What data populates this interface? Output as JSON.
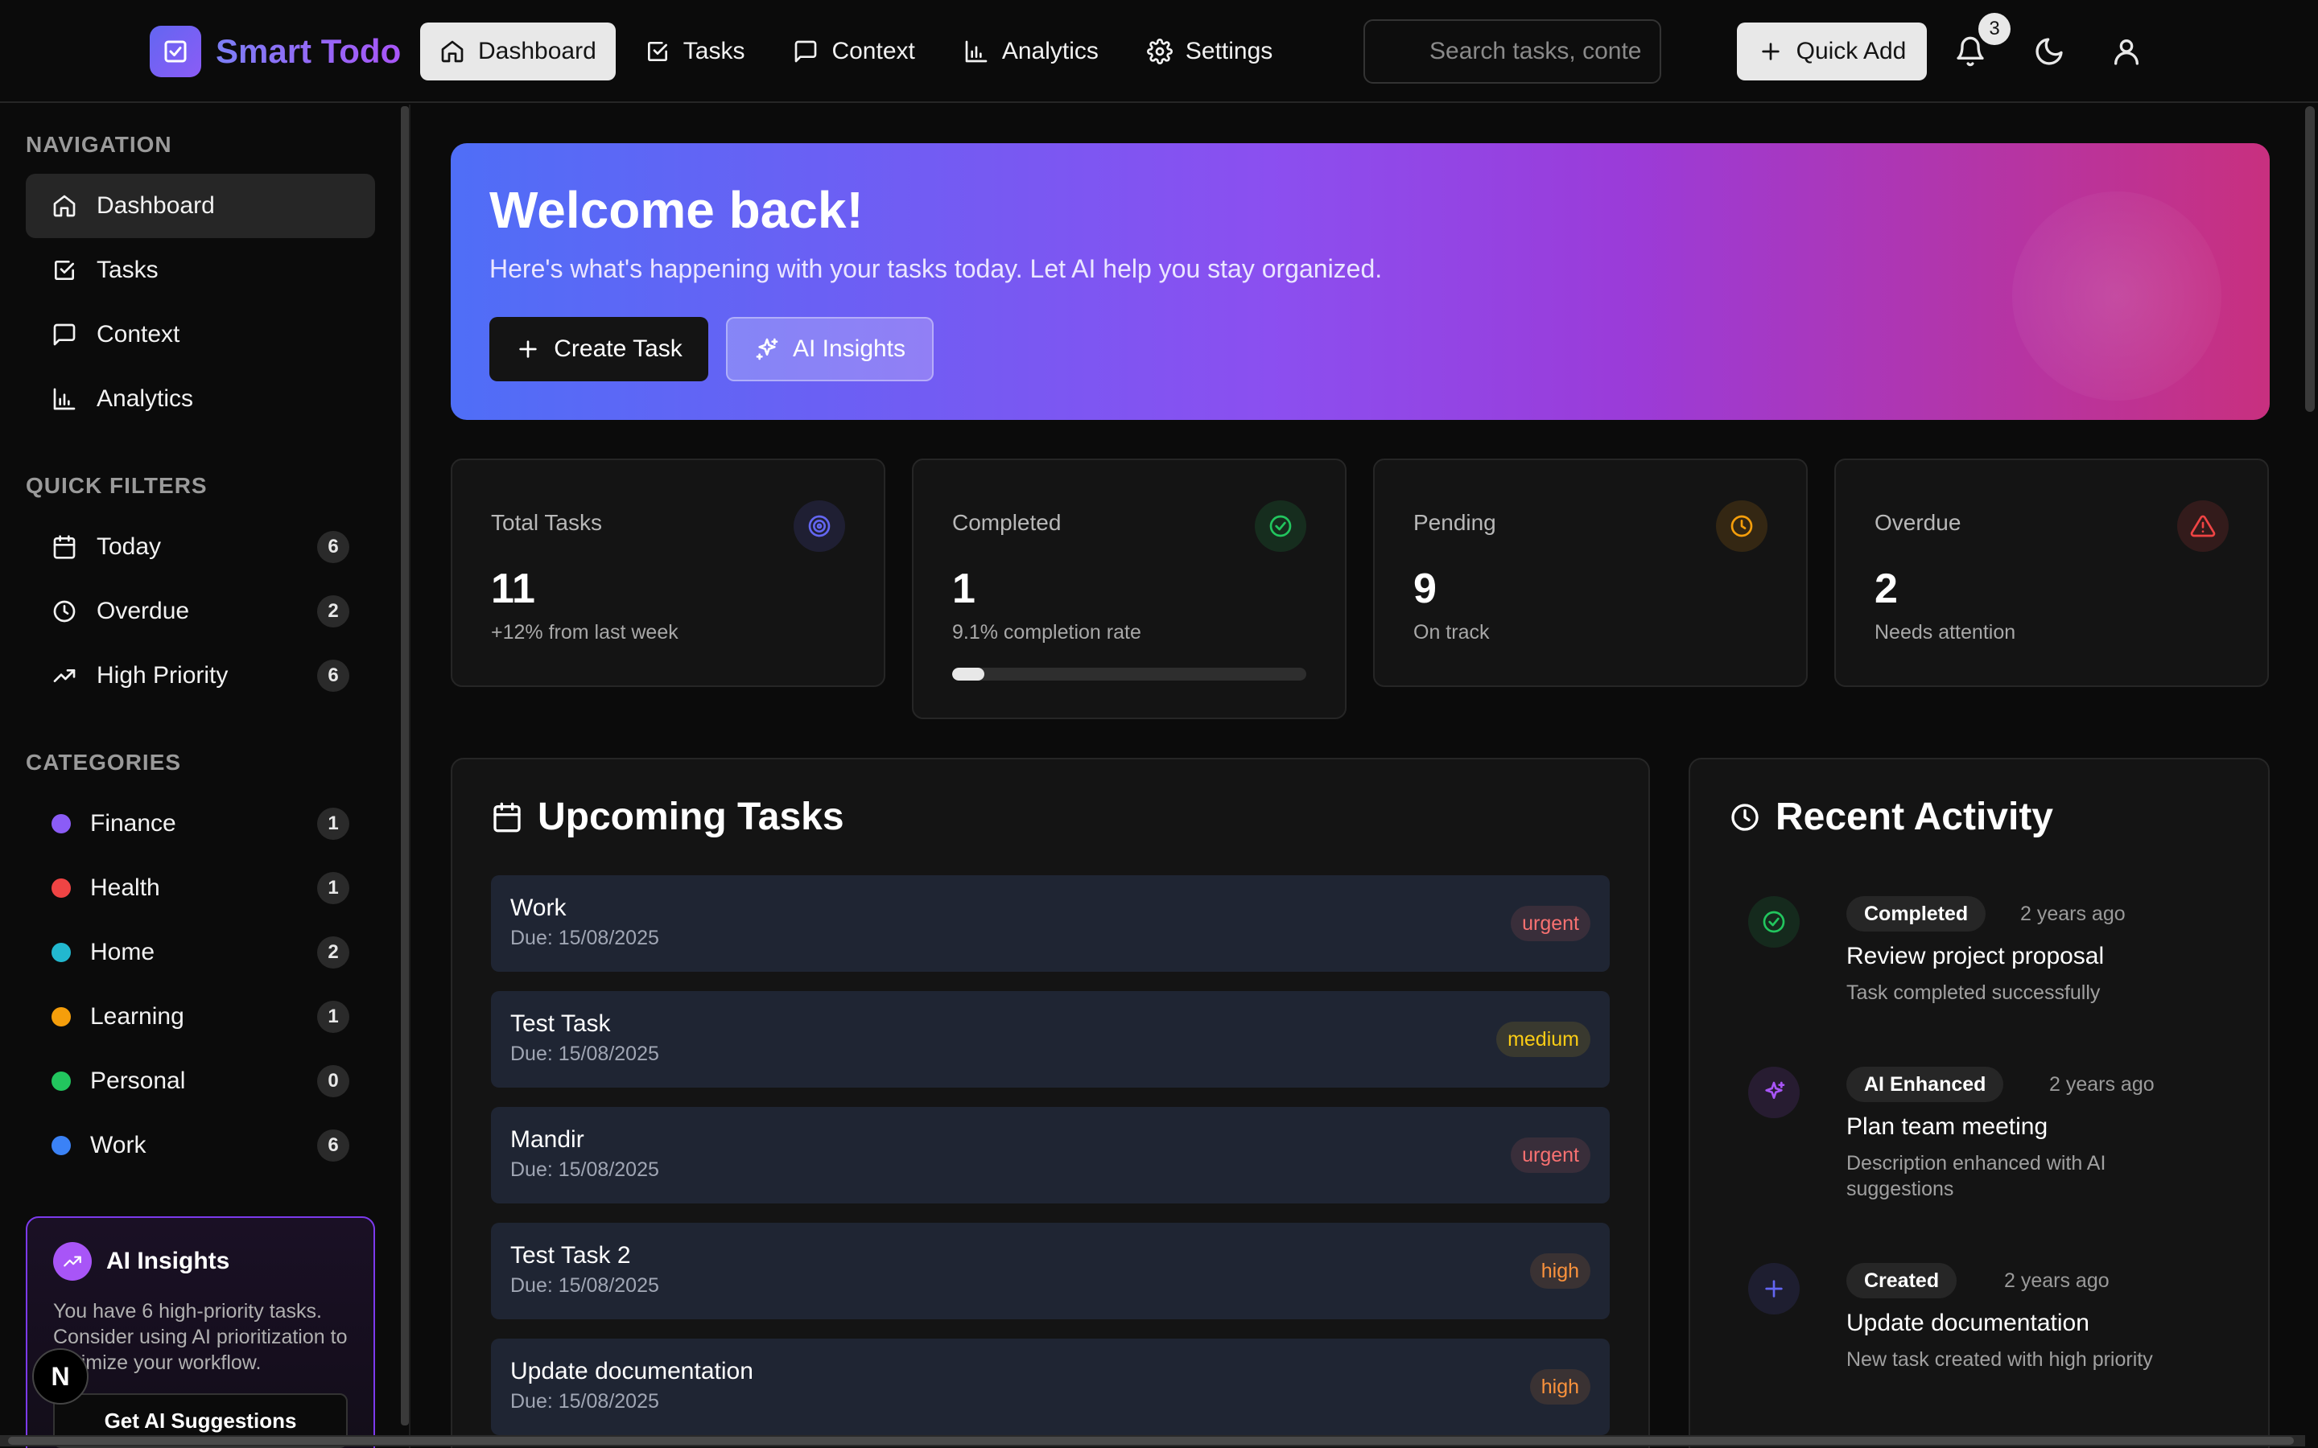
{
  "app": {
    "name": "Smart Todo"
  },
  "topnav": {
    "items": [
      {
        "label": "Dashboard",
        "icon": "home-icon",
        "active": true
      },
      {
        "label": "Tasks",
        "icon": "checkbox-icon"
      },
      {
        "label": "Context",
        "icon": "message-icon"
      },
      {
        "label": "Analytics",
        "icon": "chart-icon"
      },
      {
        "label": "Settings",
        "icon": "gear-icon"
      }
    ]
  },
  "search": {
    "placeholder": "Search tasks, conte"
  },
  "header": {
    "quick_add": "Quick Add",
    "notif_count": "3"
  },
  "sidebar": {
    "nav_title": "NAVIGATION",
    "nav": [
      {
        "label": "Dashboard",
        "icon": "home-icon"
      },
      {
        "label": "Tasks",
        "icon": "checkbox-icon"
      },
      {
        "label": "Context",
        "icon": "message-icon"
      },
      {
        "label": "Analytics",
        "icon": "chart-icon"
      }
    ],
    "filters_title": "QUICK FILTERS",
    "filters": [
      {
        "label": "Today",
        "count": "6",
        "icon": "calendar-icon"
      },
      {
        "label": "Overdue",
        "count": "2",
        "icon": "clock-icon"
      },
      {
        "label": "High Priority",
        "count": "6",
        "icon": "trending-up-icon"
      }
    ],
    "categories_title": "CATEGORIES",
    "categories": [
      {
        "label": "Finance",
        "count": "1",
        "color": "#8b5cf6"
      },
      {
        "label": "Health",
        "count": "1",
        "color": "#ef4444"
      },
      {
        "label": "Home",
        "count": "2",
        "color": "#22b8cf"
      },
      {
        "label": "Learning",
        "count": "1",
        "color": "#f59e0b"
      },
      {
        "label": "Personal",
        "count": "0",
        "color": "#22c55e"
      },
      {
        "label": "Work",
        "count": "6",
        "color": "#3b82f6"
      }
    ],
    "ai": {
      "title": "AI Insights",
      "text": "You have 6 high-priority tasks. Consider using AI prioritization to optimize your workflow.",
      "button": "Get AI Suggestions"
    },
    "n_badge": "N"
  },
  "hero": {
    "title": "Welcome back!",
    "subtitle": "Here's what's happening with your tasks today. Let AI help you stay organized.",
    "create_btn": "Create Task",
    "ai_btn": "AI Insights"
  },
  "stats": [
    {
      "label": "Total Tasks",
      "value": "11",
      "sub": "+12% from last week",
      "icon": "target-icon",
      "color": "#6366f1"
    },
    {
      "label": "Completed",
      "value": "1",
      "sub": "9.1% completion rate",
      "icon": "check-circle-icon",
      "color": "#22c55e",
      "progress": 0.091
    },
    {
      "label": "Pending",
      "value": "9",
      "sub": "On track",
      "icon": "clock-icon",
      "color": "#f59e0b"
    },
    {
      "label": "Overdue",
      "value": "2",
      "sub": "Needs attention",
      "icon": "alert-icon",
      "color": "#ef4444"
    }
  ],
  "upcoming": {
    "title": "Upcoming Tasks",
    "tasks": [
      {
        "title": "Work",
        "due": "Due: 15/08/2025",
        "priority": "urgent"
      },
      {
        "title": "Test Task",
        "due": "Due: 15/08/2025",
        "priority": "medium"
      },
      {
        "title": "Mandir",
        "due": "Due: 15/08/2025",
        "priority": "urgent"
      },
      {
        "title": "Test Task 2",
        "due": "Due: 15/08/2025",
        "priority": "high"
      },
      {
        "title": "Update documentation",
        "due": "Due: 15/08/2025",
        "priority": "high"
      }
    ]
  },
  "priority_colors": {
    "urgent": "#f87171",
    "medium": "#facc15",
    "high": "#fb923c"
  },
  "activity": {
    "title": "Recent Activity",
    "items": [
      {
        "tag": "Completed",
        "time": "2 years ago",
        "title": "Review project proposal",
        "desc": "Task completed successfully",
        "icon": "check-circle-icon",
        "color": "#22c55e"
      },
      {
        "tag": "AI Enhanced",
        "time": "2 years ago",
        "title": "Plan team meeting",
        "desc": "Description enhanced with AI suggestions",
        "icon": "sparkles-icon",
        "color": "#a855f7"
      },
      {
        "tag": "Created",
        "time": "2 years ago",
        "title": "Update documentation",
        "desc": "New task created with high priority",
        "icon": "plus-icon",
        "color": "#6366f1"
      }
    ]
  }
}
